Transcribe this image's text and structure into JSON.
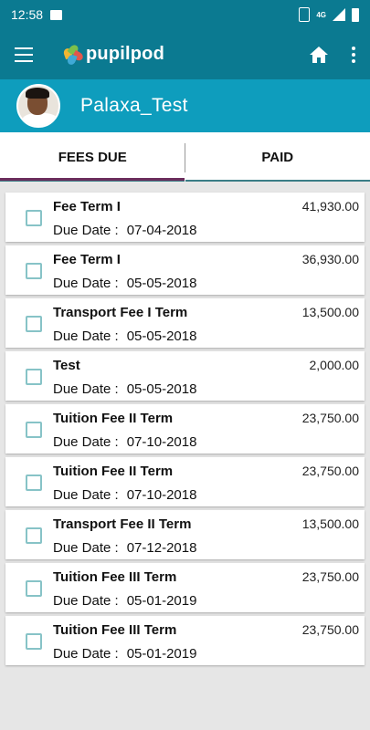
{
  "status_bar": {
    "time": "12:58",
    "network": "4G",
    "icons": [
      "image-icon",
      "vibrate-icon",
      "signal-icon",
      "battery-icon"
    ]
  },
  "app_bar": {
    "brand": "pupilpod",
    "icons": [
      "menu-icon",
      "pupilpod-logo",
      "home-icon",
      "more-vert-icon"
    ],
    "colors": {
      "primary": "#0b7a91"
    }
  },
  "profile": {
    "name": "Palaxa_Test",
    "colors": {
      "band": "#0e9dbd"
    }
  },
  "tabs": [
    {
      "label": "FEES DUE",
      "active": true
    },
    {
      "label": "PAID",
      "active": false
    }
  ],
  "fees": [
    {
      "title": "Fee Term I",
      "amount": "41,930.00",
      "due_label": "Due Date :",
      "due_date": "07-04-2018"
    },
    {
      "title": "Fee Term I",
      "amount": "36,930.00",
      "due_label": "Due Date :",
      "due_date": "05-05-2018"
    },
    {
      "title": "Transport Fee I Term",
      "amount": "13,500.00",
      "due_label": "Due Date :",
      "due_date": "05-05-2018"
    },
    {
      "title": "Test",
      "amount": "2,000.00",
      "due_label": "Due Date :",
      "due_date": "05-05-2018"
    },
    {
      "title": "Tuition Fee II Term",
      "amount": "23,750.00",
      "due_label": "Due Date :",
      "due_date": "07-10-2018"
    },
    {
      "title": "Tuition Fee II Term",
      "amount": "23,750.00",
      "due_label": "Due Date :",
      "due_date": "07-10-2018"
    },
    {
      "title": "Transport Fee II Term",
      "amount": "13,500.00",
      "due_label": "Due Date :",
      "due_date": "07-12-2018"
    },
    {
      "title": "Tuition Fee III Term",
      "amount": "23,750.00",
      "due_label": "Due Date :",
      "due_date": "05-01-2019"
    },
    {
      "title": "Tuition Fee III Term",
      "amount": "23,750.00",
      "due_label": "Due Date :",
      "due_date": "05-01-2019"
    }
  ]
}
